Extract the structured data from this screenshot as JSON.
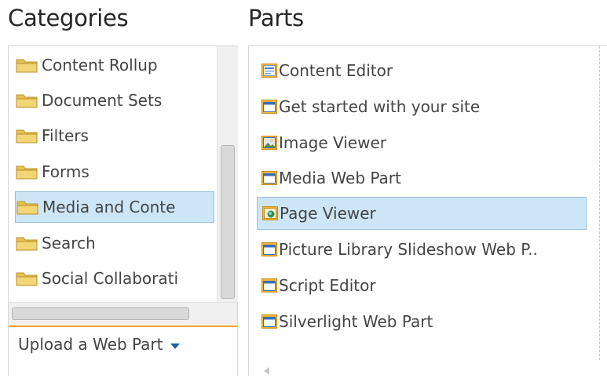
{
  "headings": {
    "categories": "Categories",
    "parts": "Parts"
  },
  "categories": [
    {
      "label": "Content Rollup",
      "icon": "folder-icon"
    },
    {
      "label": "Document Sets",
      "icon": "folder-icon"
    },
    {
      "label": "Filters",
      "icon": "folder-icon"
    },
    {
      "label": "Forms",
      "icon": "folder-icon"
    },
    {
      "label": "Media and Conte",
      "icon": "folder-icon",
      "selected": true
    },
    {
      "label": "Search",
      "icon": "folder-icon"
    },
    {
      "label": "Social Collaborati",
      "icon": "folder-icon"
    }
  ],
  "upload": {
    "label": "Upload a Web Part",
    "icon": "caret-down-icon"
  },
  "parts": [
    {
      "label": "Content Editor",
      "icon": "content-editor-icon"
    },
    {
      "label": "Get started with your site",
      "icon": "webpart-window-icon"
    },
    {
      "label": "Image Viewer",
      "icon": "image-viewer-icon"
    },
    {
      "label": "Media Web Part",
      "icon": "webpart-window-icon"
    },
    {
      "label": "Page Viewer",
      "icon": "page-viewer-icon",
      "selected": true
    },
    {
      "label": "Picture Library Slideshow Web P..",
      "icon": "webpart-window-icon"
    },
    {
      "label": "Script Editor",
      "icon": "webpart-window-icon"
    },
    {
      "label": "Silverlight Web Part",
      "icon": "webpart-window-icon"
    }
  ],
  "colors": {
    "selection_bg": "#cde6f7",
    "selection_border": "#92c0e0",
    "accent_rule": "#f0a030",
    "folder": "#e8c250"
  }
}
